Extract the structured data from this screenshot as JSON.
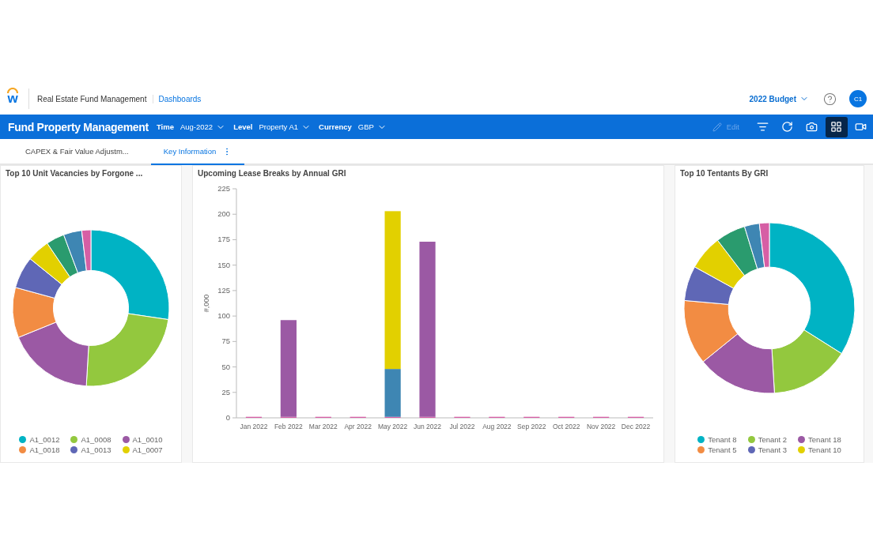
{
  "header": {
    "logo": "w",
    "app_name": "Real Estate Fund Management",
    "breadcrumb": "Dashboards",
    "budget": "2022 Budget",
    "avatar": "C1"
  },
  "toolbar": {
    "title": "Fund Property Management",
    "filters": [
      {
        "label": "Time",
        "value": "Aug-2022"
      },
      {
        "label": "Level",
        "value": "Property A1"
      },
      {
        "label": "Currency",
        "value": "GBP"
      }
    ],
    "edit": {
      "label": "Edit",
      "disabled": true
    },
    "tools": [
      {
        "kind": "filter",
        "selected": false
      },
      {
        "kind": "refresh",
        "selected": false
      },
      {
        "kind": "camera",
        "selected": false
      },
      {
        "kind": "grid",
        "selected": true
      },
      {
        "kind": "video",
        "selected": false
      }
    ]
  },
  "tabs": [
    {
      "label": "CAPEX & Fair Value Adjustm...",
      "selected": false
    },
    {
      "label": "Key Information",
      "selected": true
    }
  ],
  "panels": [
    {
      "kind": "donut",
      "title": "Top 10 Unit Vacancies by Forgone ...",
      "legend": [
        {
          "label": "A1_0012",
          "color": "#00b3c4"
        },
        {
          "label": "A1_0008",
          "color": "#93c83e"
        },
        {
          "label": "A1_0010",
          "color": "#9b59a4"
        },
        {
          "label": "A1_0018",
          "color": "#f28c43"
        },
        {
          "label": "A1_0013",
          "color": "#5f67b6"
        },
        {
          "label": "A1_0007",
          "color": "#e2d000"
        }
      ]
    },
    {
      "kind": "bar",
      "title": "Upcoming Lease Breaks by Annual GRI",
      "chart_data": {
        "type": "bar",
        "stacked": true,
        "ylabel": "#,000",
        "ylim": [
          0,
          225
        ],
        "yticks": [
          0,
          25,
          50,
          75,
          100,
          125,
          150,
          175,
          200,
          225
        ],
        "categories": [
          "Jan 2022",
          "Feb 2022",
          "Mar 2022",
          "Apr 2022",
          "May 2022",
          "Jun 2022",
          "Jul 2022",
          "Aug 2022",
          "Sep 2022",
          "Oct 2022",
          "Nov 2022",
          "Dec 2022"
        ],
        "series": [
          {
            "color": "#d65fa5",
            "values": [
              1,
              1,
              1,
              1,
              1,
              1,
              1,
              1,
              1,
              1,
              1,
              1
            ]
          },
          {
            "color": "#3e86b3",
            "values": [
              0,
              0,
              0,
              0,
              47,
              0,
              0,
              0,
              0,
              0,
              0,
              0
            ]
          },
          {
            "color": "#9b59a4",
            "values": [
              0,
              95,
              0,
              0,
              0,
              172,
              0,
              0,
              0,
              0,
              0,
              0
            ]
          },
          {
            "color": "#e2d000",
            "values": [
              0,
              0,
              0,
              0,
              155,
              0,
              0,
              0,
              0,
              0,
              0,
              0
            ]
          }
        ]
      }
    },
    {
      "kind": "donut",
      "title": "Top 10 Tentants By GRI",
      "legend": [
        {
          "label": "Tenant 8",
          "color": "#00b3c4"
        },
        {
          "label": "Tenant 2",
          "color": "#93c83e"
        },
        {
          "label": "Tenant 18",
          "color": "#9b59a4"
        },
        {
          "label": "Tenant 5",
          "color": "#f28c43"
        },
        {
          "label": "Tenant 3",
          "color": "#5f67b6"
        },
        {
          "label": "Tenant 10",
          "color": "#e2d000"
        }
      ]
    }
  ]
}
